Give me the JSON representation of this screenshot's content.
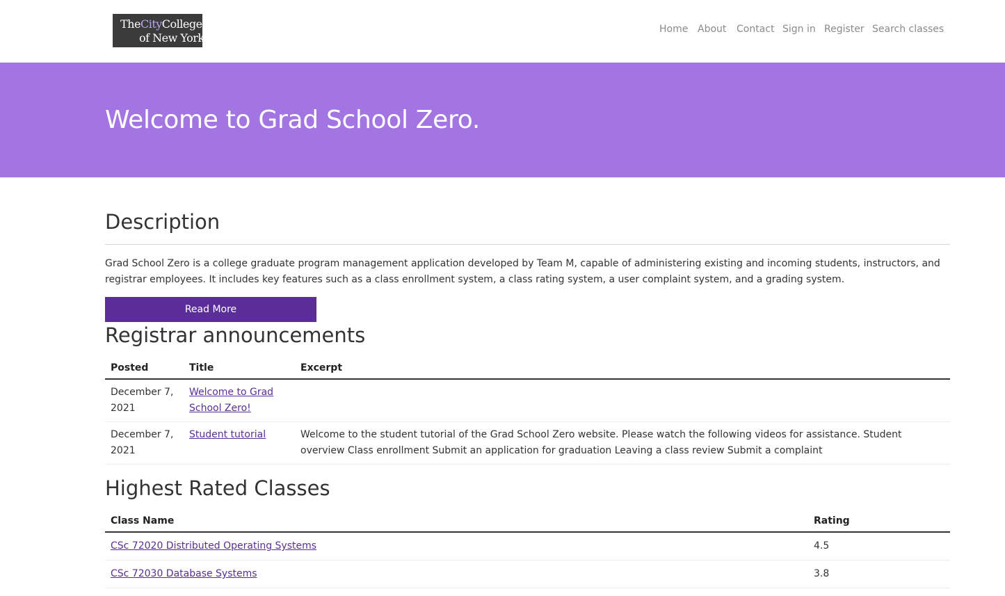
{
  "logo": {
    "line1_pre": "The",
    "line1_city": "City",
    "line1_post": "College",
    "line2": "of New York"
  },
  "nav": {
    "items": [
      {
        "label": "Home"
      },
      {
        "label": "About"
      },
      {
        "label": "Contact"
      },
      {
        "label": "Sign in"
      },
      {
        "label": "Register"
      },
      {
        "label": "Search classes"
      }
    ]
  },
  "hero": {
    "title": "Welcome to Grad School Zero.",
    "background": "#a275e2"
  },
  "description": {
    "title": "Description",
    "text": "Grad School Zero is a college graduate program management application developed by Team M, capable of administering existing and incoming students, instructors, and registrar employees. It includes key features such as a class enrollment system, a class rating system, a user complaint system, and a grading system.",
    "button_label": "Read More",
    "button_color": "#5a2d97"
  },
  "announcements": {
    "title": "Registrar announcements",
    "columns": [
      "Posted",
      "Title",
      "Excerpt"
    ],
    "rows": [
      {
        "posted": "December 7, 2021",
        "title": "Welcome to Grad School Zero!",
        "excerpt": ""
      },
      {
        "posted": "December 7, 2021",
        "title": "Student tutorial",
        "excerpt": "Welcome to the student tutorial of the Grad School Zero website. Please watch the following videos for assistance. Student overview Class enrollment Submit an application for graduation Leaving a class review Submit a complaint"
      }
    ]
  },
  "classes": {
    "title": "Highest Rated Classes",
    "columns": [
      "Class Name",
      "Rating"
    ],
    "rows": [
      {
        "name": "CSc 72020 Distributed Operating Systems",
        "rating": "4.5"
      },
      {
        "name": "CSc 72030 Database Systems",
        "rating": "3.8"
      }
    ]
  }
}
